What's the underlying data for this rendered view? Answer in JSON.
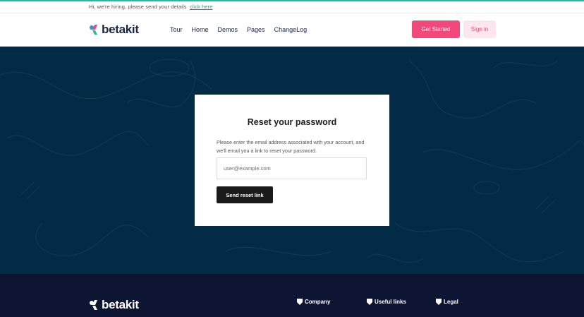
{
  "announcement": {
    "text": "Hi, we're hiring, please send your details",
    "link_label": "click here"
  },
  "brand": {
    "name": "betakit",
    "colors": {
      "pink": "#f2497a",
      "blue": "#3a8fd6",
      "teal": "#2bb7a4",
      "navy": "#1b2340"
    }
  },
  "nav": {
    "links": [
      "Tour",
      "Home",
      "Demos",
      "Pages",
      "ChangeLog"
    ],
    "get_started_label": "Get Started",
    "sign_in_label": "Sign in"
  },
  "reset_card": {
    "title": "Reset your password",
    "description": "Please enter the email address associated with your account, and we'll email you a link to reset your password.",
    "email_placeholder": "user@example.com",
    "submit_label": "Send reset link"
  },
  "footer": {
    "brand_name": "betakit",
    "columns": [
      {
        "label": "Company",
        "icon": "shield-icon"
      },
      {
        "label": "Useful links",
        "icon": "shield-icon"
      },
      {
        "label": "Legal",
        "icon": "shield-icon"
      }
    ]
  }
}
